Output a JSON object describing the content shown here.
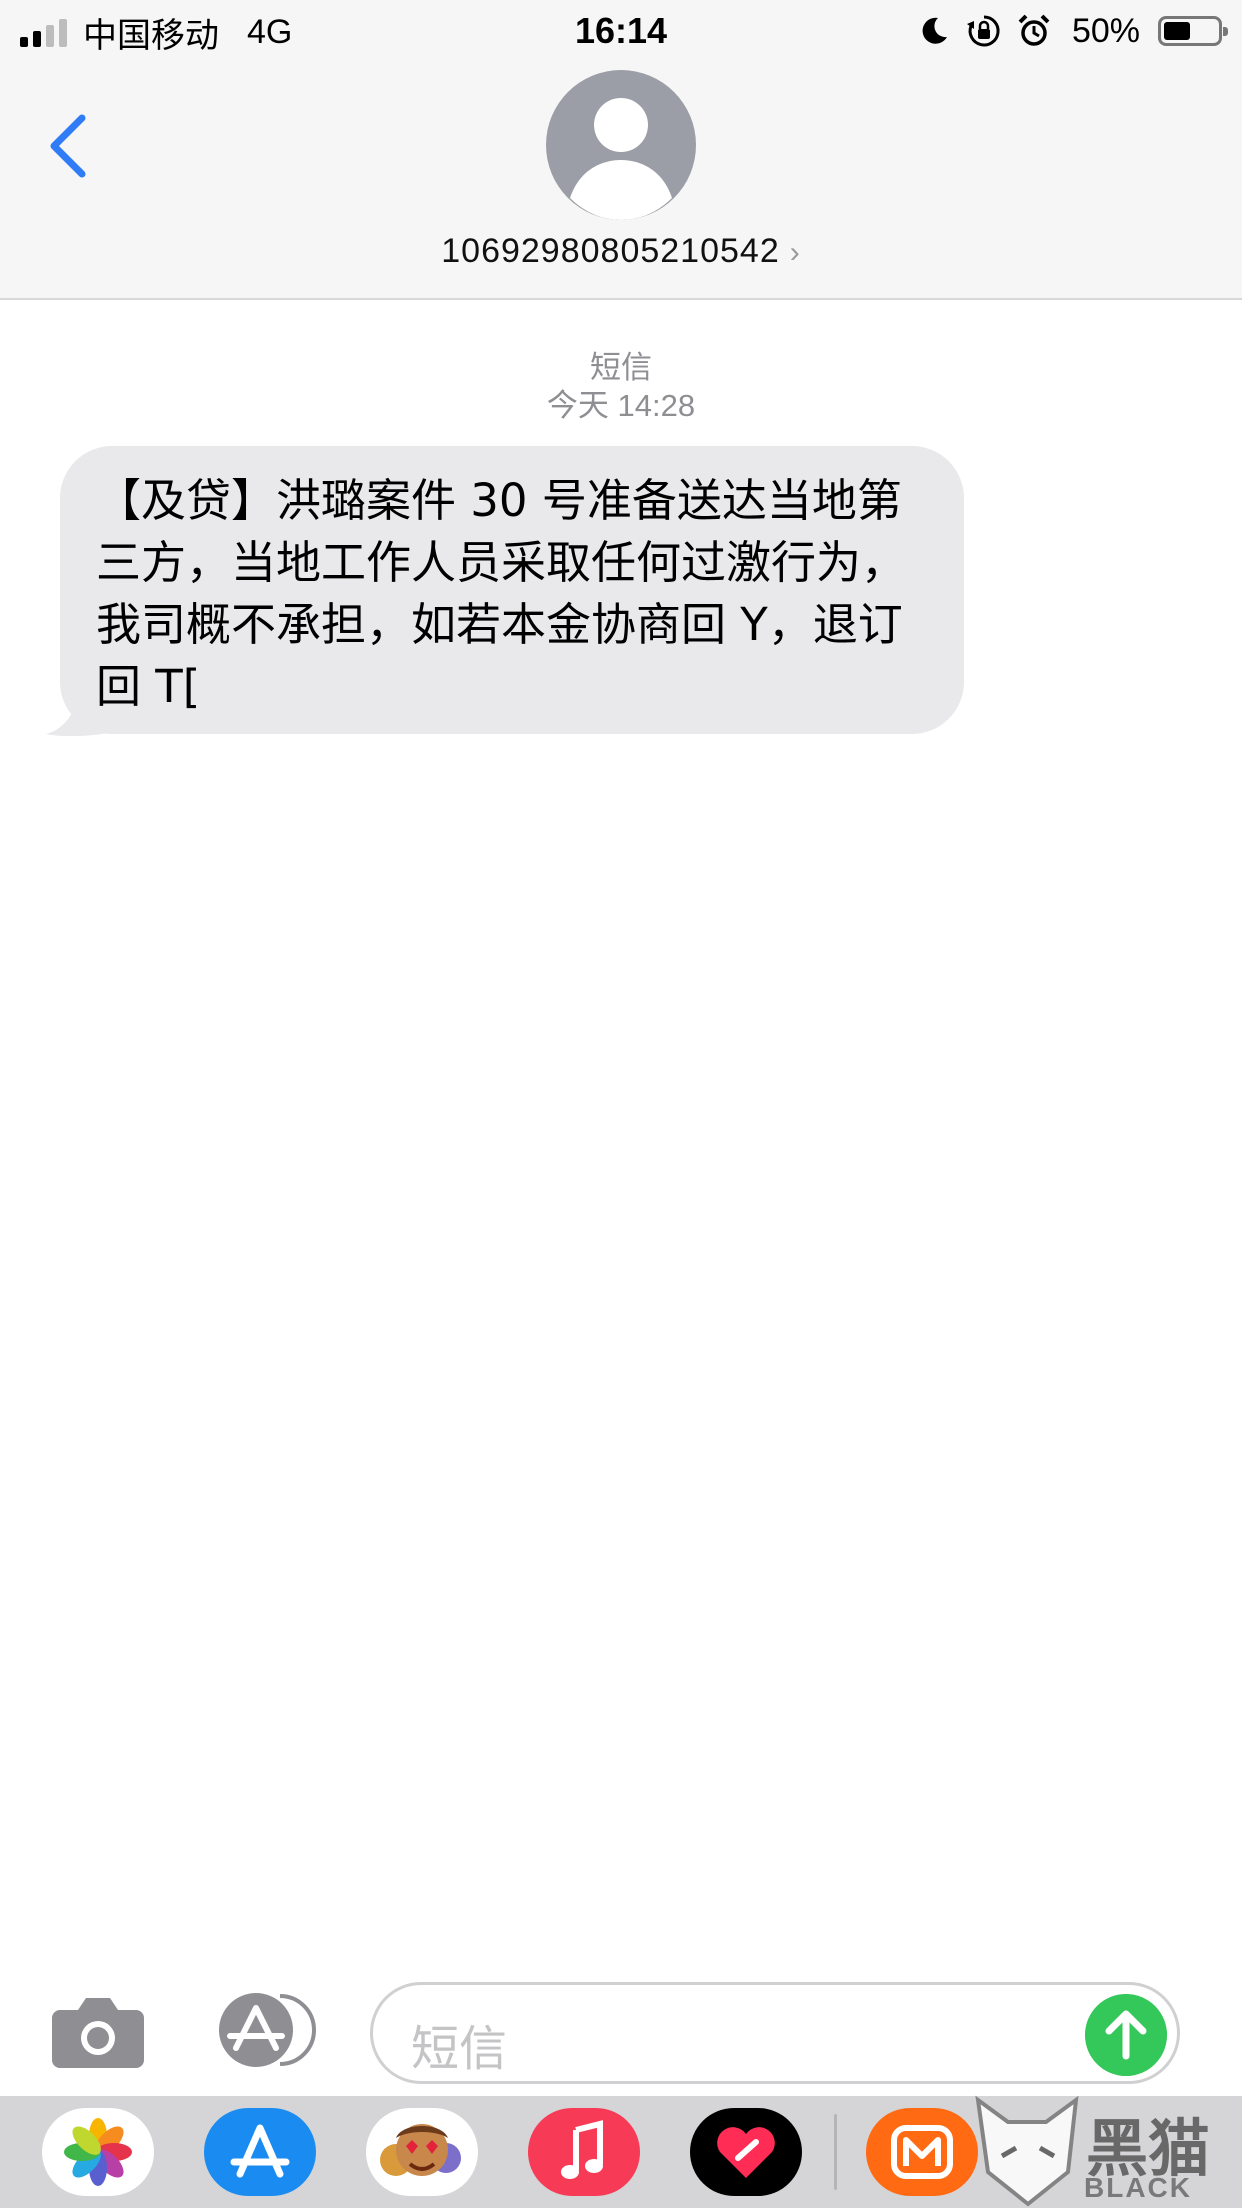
{
  "status_bar": {
    "carrier": "中国移动",
    "network": "4G",
    "time": "16:14",
    "battery_percent": "50%",
    "battery_level": 0.5,
    "signal_bars": 4,
    "signal_bars_active": 2,
    "icons": [
      "signal-icon",
      "moon-icon",
      "rotation-lock-icon",
      "alarm-icon",
      "battery-icon"
    ]
  },
  "header": {
    "contact_number": "10692980805210542",
    "contact_chevron": "›",
    "back_icon": "chevron-left-icon",
    "avatar_icon": "person-icon"
  },
  "thread": {
    "service_label": "短信",
    "timestamp": "今天 14:28",
    "messages": [
      {
        "direction": "incoming",
        "text": "【及贷】洪璐案件 30 号准备送达当地第三方，当地工作人员采取任何过激行为，我司概不承担，如若本金协商回 Y，退订回 T["
      }
    ]
  },
  "composer": {
    "placeholder": "短信",
    "camera_icon": "camera-icon",
    "apps_icon": "app-store-icon",
    "send_icon": "arrow-up-icon"
  },
  "app_drawer": {
    "apps": [
      "photos-icon",
      "app-store-icon",
      "memoji-icon",
      "music-icon",
      "digital-touch-icon",
      "mango-tv-icon"
    ]
  },
  "watermark": {
    "brand_cn": "黑猫",
    "brand_en": "BLACK CAT"
  },
  "colors": {
    "accent_blue": "#2f7cf6",
    "send_green": "#34c759",
    "bubble_gray": "#e9e9eb",
    "meta_gray": "#8e8e93"
  }
}
